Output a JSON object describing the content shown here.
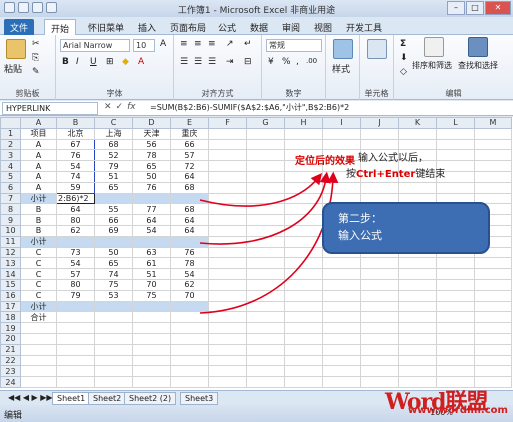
{
  "window": {
    "title": "工作簿1 - Microsoft Excel 非商业用途"
  },
  "tabs": [
    "文件",
    "开始",
    "怀旧菜单",
    "插入",
    "页面布局",
    "公式",
    "数据",
    "审阅",
    "视图",
    "开发工具"
  ],
  "ribbon": {
    "paste": "粘贴",
    "font_name": "Arial Narrow",
    "font_size": "10",
    "number_format": "常规",
    "styles": "样式",
    "sort_filter": "排序和筛选",
    "find_select": "查找和选择",
    "groups": {
      "clipboard": "剪贴板",
      "font": "字体",
      "align": "对齐方式",
      "number": "数字",
      "cells": "单元格",
      "edit": "编辑"
    }
  },
  "formula_bar": {
    "name_box": "HYPERLINK",
    "formula": "=SUM(B$2:B6)-SUMIF($A$2:$A6,\"小计\",B$2:B6)*2"
  },
  "columns": [
    "A",
    "B",
    "C",
    "D",
    "E",
    "F",
    "G",
    "H",
    "I",
    "J",
    "K",
    "L",
    "M"
  ],
  "rows": [
    {
      "n": "1",
      "cells": [
        "项目",
        "北京",
        "上海",
        "天津",
        "重庆"
      ]
    },
    {
      "n": "2",
      "cells": [
        "A",
        "67",
        "68",
        "56",
        "66"
      ]
    },
    {
      "n": "3",
      "cells": [
        "A",
        "76",
        "52",
        "78",
        "57"
      ]
    },
    {
      "n": "4",
      "cells": [
        "A",
        "54",
        "79",
        "65",
        "72"
      ]
    },
    {
      "n": "5",
      "cells": [
        "A",
        "74",
        "51",
        "50",
        "64"
      ]
    },
    {
      "n": "6",
      "cells": [
        "A",
        "59",
        "65",
        "76",
        "68"
      ]
    },
    {
      "n": "7",
      "cells": [
        "小计",
        "2:B6)*2",
        "",
        "",
        ""
      ],
      "sub": true
    },
    {
      "n": "8",
      "cells": [
        "B",
        "64",
        "55",
        "77",
        "68"
      ]
    },
    {
      "n": "9",
      "cells": [
        "B",
        "80",
        "66",
        "64",
        "64"
      ]
    },
    {
      "n": "10",
      "cells": [
        "B",
        "62",
        "69",
        "54",
        "64"
      ]
    },
    {
      "n": "11",
      "cells": [
        "小计",
        "",
        "",
        "",
        ""
      ],
      "sub": true
    },
    {
      "n": "12",
      "cells": [
        "C",
        "73",
        "50",
        "63",
        "76"
      ]
    },
    {
      "n": "13",
      "cells": [
        "C",
        "54",
        "65",
        "61",
        "78"
      ]
    },
    {
      "n": "14",
      "cells": [
        "C",
        "57",
        "74",
        "51",
        "54"
      ]
    },
    {
      "n": "15",
      "cells": [
        "C",
        "80",
        "75",
        "70",
        "62"
      ]
    },
    {
      "n": "16",
      "cells": [
        "C",
        "79",
        "53",
        "75",
        "70"
      ]
    },
    {
      "n": "17",
      "cells": [
        "小计",
        "",
        "",
        "",
        ""
      ],
      "sub": true
    },
    {
      "n": "18",
      "cells": [
        "合计",
        "",
        "",
        "",
        ""
      ]
    },
    {
      "n": "19",
      "cells": [
        "",
        "",
        "",
        "",
        ""
      ]
    },
    {
      "n": "20",
      "cells": [
        "",
        "",
        "",
        "",
        ""
      ]
    },
    {
      "n": "21",
      "cells": [
        "",
        "",
        "",
        "",
        ""
      ]
    },
    {
      "n": "22",
      "cells": [
        "",
        "",
        "",
        "",
        ""
      ]
    },
    {
      "n": "23",
      "cells": [
        "",
        "",
        "",
        "",
        ""
      ]
    },
    {
      "n": "24",
      "cells": [
        "",
        "",
        "",
        "",
        ""
      ]
    }
  ],
  "annotations": {
    "callout": "定位后的效果",
    "note_line1": "输入公式以后，",
    "note_prefix": "按",
    "note_key": "Ctrl+Enter",
    "note_suffix": "键结束",
    "step_line1": "第二步：",
    "step_line2": "输入公式",
    "arrow_color": "#e0001b"
  },
  "sheets": [
    "Sheet1",
    "Sheet2",
    "Sheet2 (2)",
    "Sheet3"
  ],
  "status": {
    "mode": "编辑",
    "zoom": "100%"
  },
  "watermark": {
    "logo": "Word联盟",
    "url": "www.wordlm.com"
  }
}
